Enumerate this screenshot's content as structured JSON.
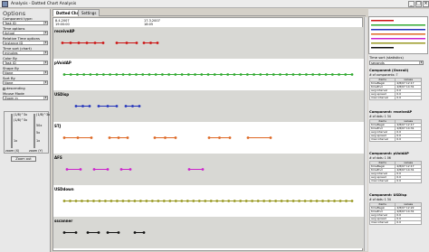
{
  "window": {
    "title": "Analysis - Dotted Chart Analysis",
    "controls": [
      "_",
      "□",
      "×"
    ]
  },
  "options": {
    "title": "Options",
    "component_type_label": "Component type:",
    "component_type_value": "Task ID",
    "time_options_label": "Time options",
    "time_options_value": "Actual",
    "relative_time_label": "Relative Time options",
    "relative_time_value": "Instance ID",
    "time_sort_label": "Time sort (chart)",
    "time_sort_value": "minutes",
    "color_by_label": "Color By",
    "color_by_value": "Task ID",
    "shape_by_label": "Shape By",
    "shape_by_value": "None",
    "sort_by_label": "Sort By",
    "sort_by_value": "None",
    "descending_label": "descending",
    "mouse_mode_label": "Mouse Mode",
    "mouse_mode_value": "Zoom in",
    "zoom_left_top": "(1/8)^3x",
    "zoom_right_top": "(1/8)^3x",
    "zoom_mid_a": "50x",
    "zoom_mid_b": "5x",
    "zoom_bottom": "1x",
    "zoom_x_label": "zoom (X)",
    "zoom_y_label": "zoom (Y)",
    "zoom_out_label": "Zoom out"
  },
  "tabs": [
    {
      "label": "Dotted Chart"
    },
    {
      "label": "Settings"
    }
  ],
  "chart": {
    "timestamps": [
      "8.4.2007",
      "17.3.2007"
    ],
    "times": [
      "19:00:00",
      "18:05"
    ],
    "rows": [
      {
        "label": "receiveAP",
        "color": "#cc1111"
      },
      {
        "label": "pVoidAP",
        "color": "#33aa33"
      },
      {
        "label": "USDisp",
        "color": "#2233bb"
      },
      {
        "label": "STJ",
        "color": "#dd6622"
      },
      {
        "label": "AFS",
        "color": "#cc22cc"
      },
      {
        "label": "USDdown",
        "color": "#999922"
      },
      {
        "label": "sscanner",
        "color": "#111111"
      }
    ]
  },
  "right_panel": {
    "time_sort_label": "Time sort (statistics)",
    "time_sort_value": "seconds",
    "component_overall_label": "Component (Overall)",
    "components": [
      {
        "title": "Component: receiveAP",
        "count": "# of dots: 1 34",
        "col_items": "items",
        "col_values": "values",
        "rows": [
          [
            "timeBegin",
            "4/8/07 12:17"
          ],
          [
            "timeEnd",
            "4/8/07 14:31"
          ],
          [
            "avg interval",
            "0.0"
          ],
          [
            "avg spread",
            "0.0"
          ],
          [
            "max interval",
            "0.0"
          ]
        ]
      },
      {
        "title": "Component: pVoidAP",
        "count": "# of dots: 1 06",
        "col_items": "items",
        "col_values": "values",
        "rows": [
          [
            "timeBegin",
            "4/8/07 12:17"
          ],
          [
            "timeEnd",
            "4/8/07 14:31"
          ],
          [
            "avg interval",
            "0.0"
          ],
          [
            "avg spread",
            "0.0"
          ],
          [
            "max interval",
            "0.0"
          ]
        ]
      },
      {
        "title": "Component: USDisp",
        "count": "# of dots: 1 34",
        "col_items": "items",
        "col_values": "values",
        "rows": [
          [
            "timeBegin",
            "4/8/07 12:22"
          ],
          [
            "timeEnd",
            "4/8/07 14:31"
          ],
          [
            "avg interval",
            "0.0"
          ],
          [
            "avg spread",
            "0.0"
          ],
          [
            "max interval",
            "0.0"
          ]
        ]
      }
    ],
    "overall": {
      "count": "# of components: 7",
      "col_items": "items",
      "col_values": "values",
      "rows": [
        [
          "timeBegin",
          "4/8/07 12:17"
        ],
        [
          "timeEnd",
          "4/8/07 14:31"
        ],
        [
          "avg interval",
          "0.0"
        ],
        [
          "avg spread",
          "0.0"
        ],
        [
          "max interval",
          "0.0"
        ]
      ]
    }
  }
}
